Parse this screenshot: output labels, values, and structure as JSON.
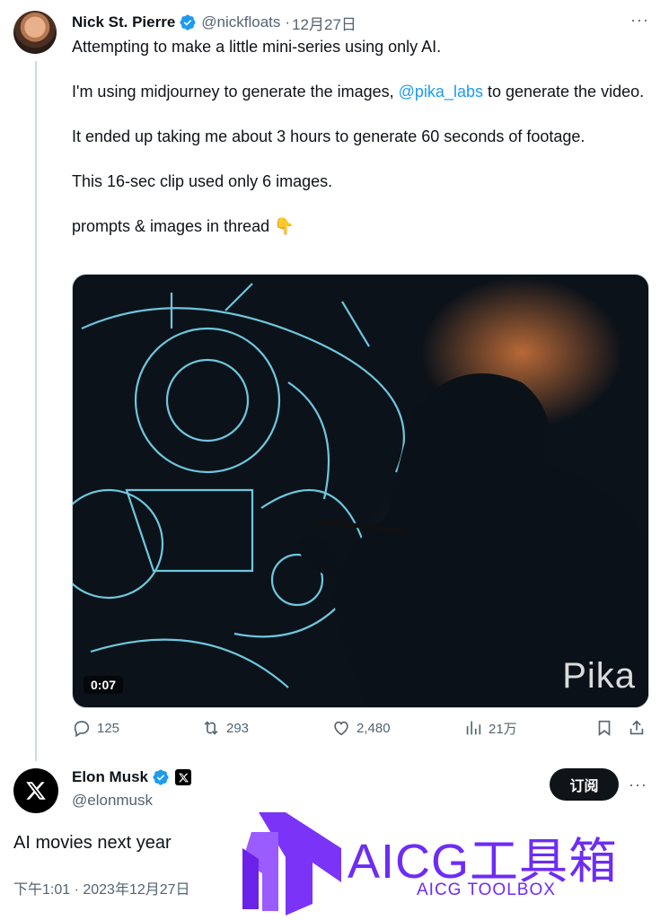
{
  "tweet": {
    "author_name": "Nick St. Pierre",
    "author_handle": "@nickfloats",
    "date": "12月27日",
    "more": "···",
    "para1": "Attempting to make a little mini-series using only AI.",
    "para2_pre": "I'm using midjourney to generate the images, ",
    "para2_mention": "@pika_labs",
    "para2_post": " to generate the video.",
    "para3": "It ended up taking me about 3 hours to generate 60 seconds of footage.",
    "para4": "This 16-sec clip used only 6 images.",
    "para5": "prompts & images in thread 👇",
    "video": {
      "duration": "0:07",
      "watermark": "Pika"
    },
    "stats": {
      "replies": "125",
      "reposts": "293",
      "likes": "2,480",
      "views": "21万"
    }
  },
  "reply": {
    "author_name": "Elon Musk",
    "author_handle": "@elonmusk",
    "subscribe_label": "订阅",
    "more": "···",
    "text": "AI movies next year",
    "timestamp": "下午1:01 · 2023年12月27日"
  },
  "overlay": {
    "title": "AICG工具箱",
    "subtitle": "AICG TOOLBOX"
  },
  "colors": {
    "accent": "#1d9bf0",
    "brand": "#6e2cf5",
    "muted": "#536471"
  }
}
